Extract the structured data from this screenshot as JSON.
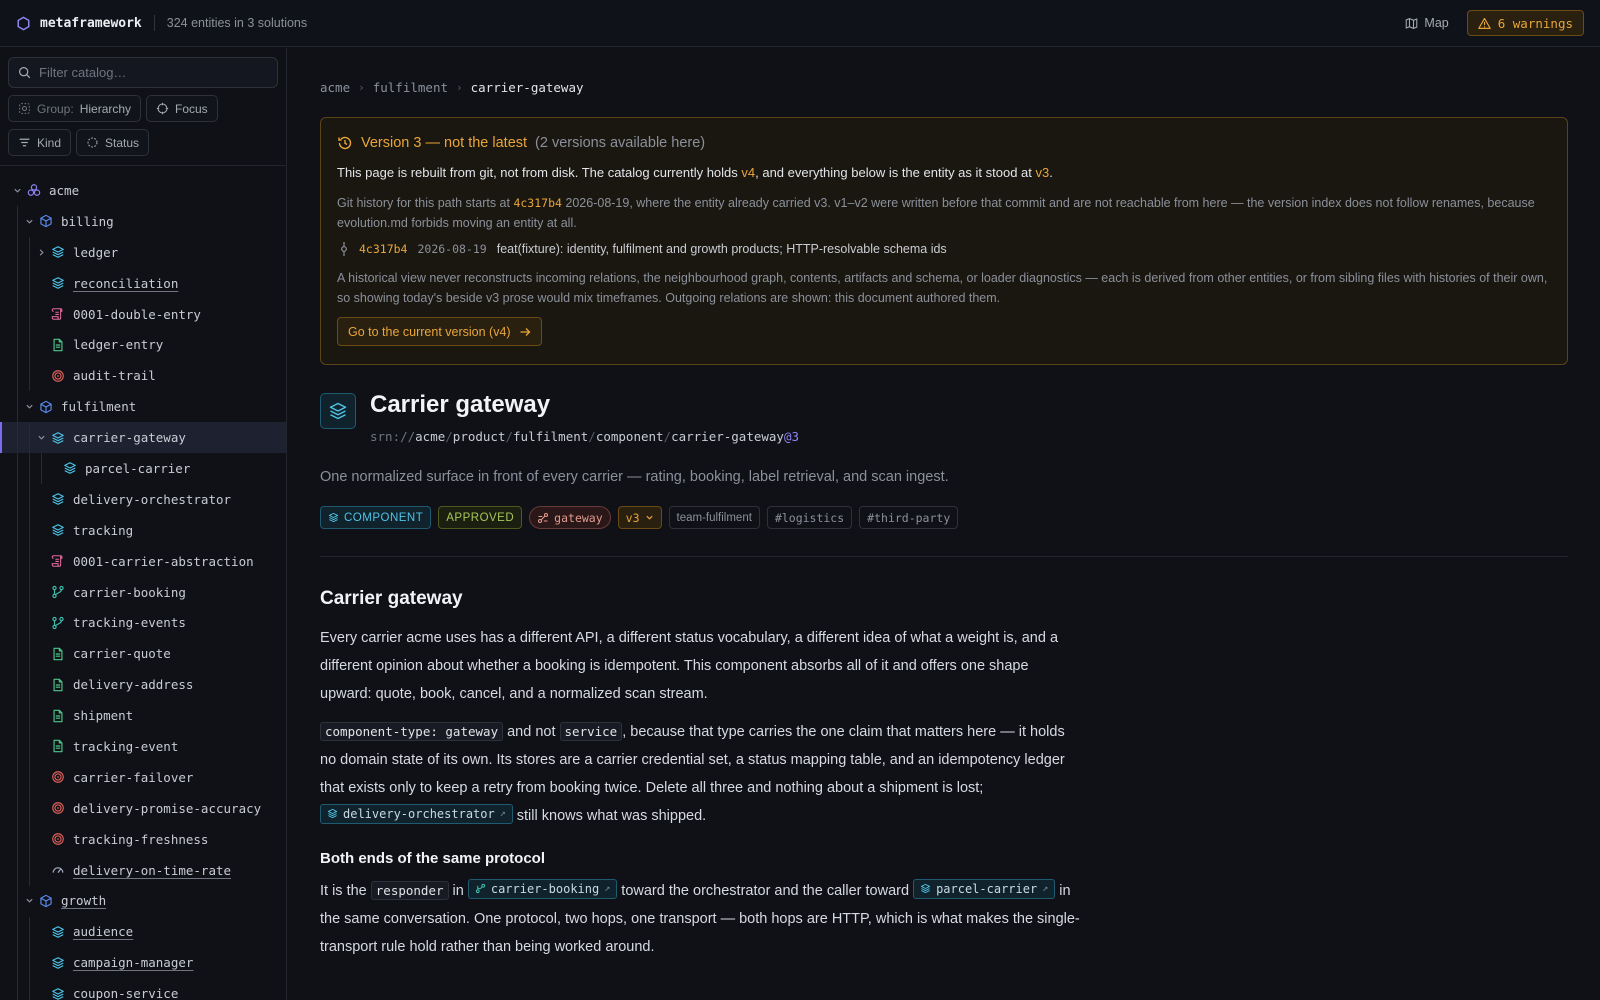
{
  "app": {
    "name": "metaframework",
    "summary": "324 entities in 3 solutions",
    "map_label": "Map",
    "warnings_label": "6 warnings"
  },
  "sidebar": {
    "filter_placeholder": "Filter catalog…",
    "group_label": "Group:",
    "group_value": "Hierarchy",
    "focus_label": "Focus",
    "kind_label": "Kind",
    "status_label": "Status",
    "tree": [
      {
        "label": "acme",
        "icon": "solution-icon",
        "depth": 0,
        "chevron": "down"
      },
      {
        "label": "billing",
        "icon": "product-icon",
        "depth": 1,
        "chevron": "down"
      },
      {
        "label": "ledger",
        "icon": "component-icon",
        "depth": 2,
        "chevron": "right"
      },
      {
        "label": "reconciliation",
        "icon": "component-icon",
        "depth": 2,
        "underline": true
      },
      {
        "label": "0001-double-entry",
        "icon": "decision-icon",
        "depth": 2
      },
      {
        "label": "ledger-entry",
        "icon": "schema-icon",
        "depth": 2
      },
      {
        "label": "audit-trail",
        "icon": "objective-icon",
        "depth": 2
      },
      {
        "label": "fulfilment",
        "icon": "product-icon",
        "depth": 1,
        "chevron": "down"
      },
      {
        "label": "carrier-gateway",
        "icon": "component-icon",
        "depth": 2,
        "chevron": "down",
        "selected": true
      },
      {
        "label": "parcel-carrier",
        "icon": "component-icon",
        "depth": 3
      },
      {
        "label": "delivery-orchestrator",
        "icon": "component-icon",
        "depth": 2
      },
      {
        "label": "tracking",
        "icon": "component-icon",
        "depth": 2
      },
      {
        "label": "0001-carrier-abstraction",
        "icon": "decision-icon",
        "depth": 2
      },
      {
        "label": "carrier-booking",
        "icon": "interface-icon",
        "depth": 2
      },
      {
        "label": "tracking-events",
        "icon": "interface-icon",
        "depth": 2
      },
      {
        "label": "carrier-quote",
        "icon": "schema-icon",
        "depth": 2
      },
      {
        "label": "delivery-address",
        "icon": "schema-icon",
        "depth": 2
      },
      {
        "label": "shipment",
        "icon": "schema-icon",
        "depth": 2
      },
      {
        "label": "tracking-event",
        "icon": "schema-icon",
        "depth": 2
      },
      {
        "label": "carrier-failover",
        "icon": "objective-icon",
        "depth": 2
      },
      {
        "label": "delivery-promise-accuracy",
        "icon": "objective-icon",
        "depth": 2
      },
      {
        "label": "tracking-freshness",
        "icon": "objective-icon",
        "depth": 2
      },
      {
        "label": "delivery-on-time-rate",
        "icon": "metric-icon",
        "depth": 2,
        "underline": true
      },
      {
        "label": "growth",
        "icon": "product-icon",
        "depth": 1,
        "chevron": "down",
        "underline": true
      },
      {
        "label": "audience",
        "icon": "component-icon",
        "depth": 2,
        "underline": true
      },
      {
        "label": "campaign-manager",
        "icon": "component-icon",
        "depth": 2,
        "underline": true
      },
      {
        "label": "coupon-service",
        "icon": "component-icon",
        "depth": 2,
        "underline": true
      }
    ]
  },
  "breadcrumb": [
    "acme",
    "fulfilment",
    "carrier-gateway"
  ],
  "banner": {
    "title": "Version 3 — not the latest",
    "subtitle": "(2 versions available here)",
    "p1_a": "This page is rebuilt from git, not from disk. The catalog currently holds ",
    "p1_v4": "v4",
    "p1_b": ", and everything below is the entity as it stood at ",
    "p1_v3": "v3",
    "p1_c": ".",
    "p2_a": "Git history for this path starts at ",
    "p2_hash": "4c317b4",
    "p2_b": " 2026-08-19, where the entity already carried v3. v1–v2 were written before that commit and are not reachable from here — the version index does not follow renames, because evolution.md forbids moving an entity at all.",
    "commit_hash": "4c317b4",
    "commit_date": "2026-08-19",
    "commit_msg": "feat(fixture): identity, fulfilment and growth products; HTTP-resolvable schema ids",
    "p3": "A historical view never reconstructs incoming relations, the neighbourhood graph, contents, artifacts and schema, or loader diagnostics — each is derived from other entities, or from sibling files with histories of their own, so showing today's beside v3 prose would mix timeframes. Outgoing relations are shown: this document authored them.",
    "button": "Go to the current version (v4)"
  },
  "entity": {
    "title": "Carrier gateway",
    "srn_scheme": "srn://",
    "srn_parts": [
      "acme",
      "product",
      "fulfilment",
      "component",
      "carrier-gateway"
    ],
    "srn_version": "@3",
    "tagline": "One normalized surface in front of every carrier — rating, booking, label retrieval, and scan ingest.",
    "badges": {
      "kind": "COMPONENT",
      "status": "APPROVED",
      "type": "gateway",
      "version": "v3",
      "team": "team-fulfilment",
      "tag1": "#logistics",
      "tag2": "#third-party"
    }
  },
  "doc": {
    "h2": "Carrier gateway",
    "p1": "Every carrier acme uses has a different API, a different status vocabulary, a different idea of what a weight is, and a different opinion about whether a booking is idempotent. This component absorbs all of it and offers one shape upward: quote, book, cancel, and a normalized scan stream.",
    "p2_code1": "component-type: gateway",
    "p2_a": " and not ",
    "p2_code2": "service",
    "p2_b": ", because that type carries the one claim that matters here — it holds no domain state of its own. Its stores are a carrier credential set, a status mapping table, and an idempotency ledger that exists only to keep a retry from booking twice. Delete all three and nothing about a shipment is lost; ",
    "p2_ref": "delivery-orchestrator",
    "p2_c": " still knows what was shipped.",
    "h3": "Both ends of the same protocol",
    "p3_a": "It is the ",
    "p3_code": "responder",
    "p3_b": " in ",
    "p3_ref1": "carrier-booking",
    "p3_c": " toward the orchestrator and the caller toward ",
    "p3_ref2": "parcel-carrier",
    "p3_d": " in the same conversation. One protocol, two hops, one transport — both hops are HTTP, which is what makes the single-transport rule hold rather than being worked around."
  },
  "colors": {
    "accent": "#7c6cf0",
    "warning": "#e9a53a",
    "component": "#4fc3e6",
    "schema": "#4ec78a",
    "decision": "#e26a9a",
    "objective": "#e0605a",
    "interface": "#3fc0b0",
    "product": "#5b8cf0"
  }
}
